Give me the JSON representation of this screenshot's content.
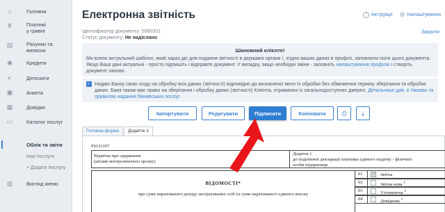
{
  "sidebar": {
    "items": [
      {
        "label": "Головна",
        "icon": "home-icon",
        "glyph": "⌂"
      },
      {
        "label": "Платежі\nу гривні",
        "icon": "hryvnia-icon",
        "glyph": "₴"
      },
      {
        "label": "Рахунки та\nвиписки",
        "icon": "accounts-icon",
        "glyph": "▤"
      },
      {
        "label": "Кредити",
        "icon": "credits-icon",
        "glyph": "◉"
      },
      {
        "label": "Депозити",
        "icon": "deposits-icon",
        "glyph": "◐"
      },
      {
        "label": "Анкета",
        "icon": "profile-form-icon",
        "glyph": "▣"
      },
      {
        "label": "Довідки",
        "icon": "certificates-icon",
        "glyph": "▦"
      },
      {
        "label": "Каталог послуг",
        "icon": "catalog-icon",
        "glyph": "▭"
      }
    ],
    "section": "Облік та звіти",
    "subitems": [
      "Інші послуги",
      "+ Додати послугу"
    ],
    "view_menu": {
      "label": "Вигляд меню",
      "icon": "view-menu-icon",
      "glyph": "▥"
    }
  },
  "header": {
    "title": "Електронна звітність",
    "instructions": "Інструкції",
    "settings": "Налаштування"
  },
  "meta": {
    "doc_id_label": "Ідентифікатор документу: 5060331",
    "status_label": "Статус документу:",
    "status_value": "Не надіслано",
    "close_link": "Закрити"
  },
  "notice": {
    "title": "Шановний клієнте!",
    "text": "Ми взяли актуальний шаблон, який зараз діє для подання звітності в державні органи і, згідно ваших даних в профілі, заповнили поля цього документа. Якщо Ваші дані актуальні - просто підпишіть і відправте документ. У випадку, якщо необхідні зміни - заповніть ",
    "link": "налаштування профілю",
    "text_end": " і створіть документ заново."
  },
  "consent": {
    "text": "Надаю Банку свою згоду на обробку всіх даних (звітності) відповідно до визначеної мети їх обробки без обмеження терміну зберігання та обробки даних. Банк також має право на зберігання і обробку даних (звітності) Клієнта, отриманих із загальнодоступних джерел. ",
    "link": "Детальніше див. в Умовах та правилах надання банківських послуг."
  },
  "actions": {
    "import": "Імпортувати",
    "edit": "Редагувати",
    "sign": "Підписати",
    "copy": "Копіювати",
    "print_icon": "⎙",
    "download_icon": "⤓"
  },
  "tabs": [
    "Головна форма",
    "Додаток 1"
  ],
  "document": {
    "code": "F0133107",
    "org_label": "Відмітка про одержання\n(штамп контролюючого органу)",
    "annex_label": "Додаток 1\nдо податкової декларації платника єдиного податку - фізичної\nособи підприємця",
    "title": "ВІДОМОСТІ*",
    "subtitle": "про суми нарахованого доходу застрахованих осіб та суми нарахованого єдиного внеску",
    "types": [
      {
        "n": "01",
        "label": "Звітна",
        "checked": true
      },
      {
        "n": "02",
        "label": "Звітна нова",
        "sup": "1",
        "checked": false
      },
      {
        "n": "03",
        "label": "Уточнююча",
        "sup": "2",
        "checked": false
      },
      {
        "n": "04",
        "label": "Довідкова",
        "sup": "3",
        "checked": false
      }
    ]
  },
  "colors": {
    "accent": "#2e7fd2",
    "arrow": "#e8161b"
  }
}
